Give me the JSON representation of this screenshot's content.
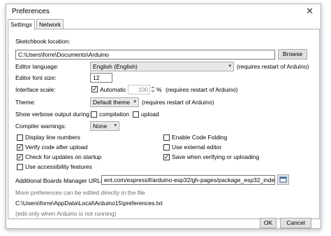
{
  "window": {
    "title": "Preferences",
    "close_glyph": "✕"
  },
  "tabs": [
    {
      "label": "Settings"
    },
    {
      "label": "Network"
    }
  ],
  "sketchbook": {
    "label": "Sketchbook location:",
    "value": "C:\\Users\\forre\\Documents\\Arduino",
    "browse_label": "Browse"
  },
  "language": {
    "label": "Editor language:",
    "value": "English (English)",
    "note": "(requires restart of Arduino)"
  },
  "font_size": {
    "label": "Editor font size:",
    "value": "12"
  },
  "scale": {
    "label": "Interface scale:",
    "automatic_label": "Automatic",
    "automatic_checked": true,
    "value": "100",
    "unit": "%",
    "note": "(requires restart of Arduino)"
  },
  "theme": {
    "label": "Theme:",
    "value": "Default theme",
    "note": "(requires restart of Arduino)"
  },
  "verbose": {
    "label": "Show verbose output during:",
    "compilation_label": "compilation",
    "upload_label": "upload"
  },
  "warnings": {
    "label": "Compiler warnings:",
    "value": "None"
  },
  "options": [
    {
      "label": "Display line numbers",
      "checked": false
    },
    {
      "label": "Enable Code Folding",
      "checked": false
    },
    {
      "label": "Verify code after upload",
      "checked": true
    },
    {
      "label": "Use external editor",
      "checked": false
    },
    {
      "label": "Check for updates on startup",
      "checked": true
    },
    {
      "label": "Save when verifying or uploading",
      "checked": true
    },
    {
      "label": "Use accessibility features",
      "checked": false
    }
  ],
  "boards": {
    "label": "Additional Boards Manager URLs:",
    "value": "ent.com/espressif/arduino-esp32/gh-pages/package_esp32_index.json"
  },
  "more_prefs": "More preferences can be edited directly in the file",
  "prefs_path": "C:\\Users\\forre\\AppData\\Local\\Arduino15\\preferences.txt",
  "edit_note": "(edit only when Arduino is not running)",
  "footer": {
    "ok_label": "OK",
    "cancel_label": "Cancel"
  },
  "check_glyph": "✓",
  "dropdown_glyph": "▾"
}
